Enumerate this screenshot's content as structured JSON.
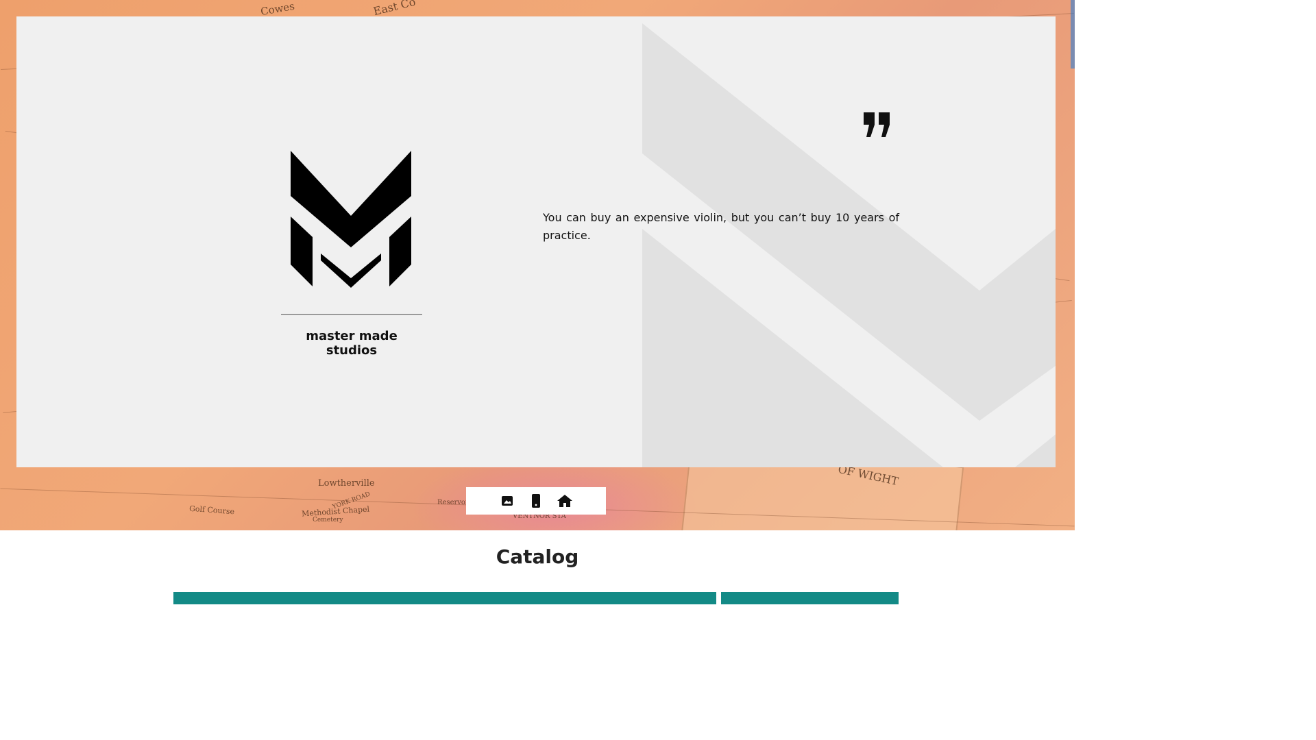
{
  "brand": {
    "name": "master made studios"
  },
  "hero": {
    "quote": "You can buy an expensive violin, but you can’t buy 10 years of practice."
  },
  "toolbar": {
    "buttons": [
      {
        "icon": "image-icon"
      },
      {
        "icon": "phone-icon"
      },
      {
        "icon": "home-icon"
      }
    ]
  },
  "catalog": {
    "title": "Catalog"
  },
  "background_map_labels": {
    "l1": "Lowtherville",
    "l2": "Golf Course",
    "l3": "Methodist Chapel",
    "l4": "Cemetery",
    "l5": "OF WIGHT",
    "l6": "East Co",
    "l7": "Cowes",
    "l8": "VENTNOR STA",
    "l9": "Reservoir",
    "l10": "YORK ROAD"
  },
  "colors": {
    "panel": "#f0f0f0",
    "accent": "#138a86",
    "map": "#eea06c",
    "text": "#111111"
  }
}
